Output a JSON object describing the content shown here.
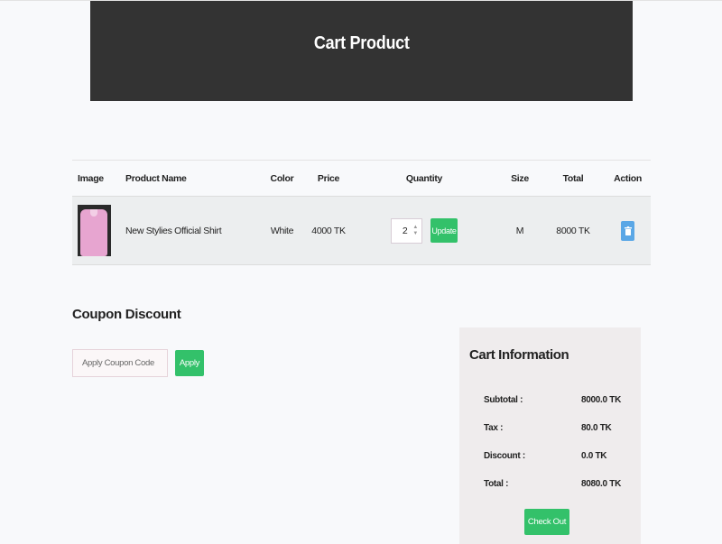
{
  "banner": {
    "title": "Cart Product"
  },
  "table": {
    "headers": {
      "image": "Image",
      "product_name": "Product Name",
      "color": "Color",
      "price": "Price",
      "quantity": "Quantity",
      "size": "Size",
      "total": "Total",
      "action": "Action"
    },
    "rows": [
      {
        "product_name": "New Stylies Official Shirt",
        "color": "White",
        "price": "4000 TK",
        "quantity": "2",
        "update_label": "Update",
        "size": "M",
        "total": "8000 TK",
        "delete_icon": "trash-icon"
      }
    ]
  },
  "coupon": {
    "title": "Coupon Discount",
    "placeholder": "Apply Coupon Code",
    "apply_label": "Apply"
  },
  "cart_info": {
    "title": "Cart Information",
    "rows": [
      {
        "label": "Subtotal :",
        "value": "8000.0 TK"
      },
      {
        "label": "Tax :",
        "value": "80.0 TK"
      },
      {
        "label": "Discount :",
        "value": "0.0 TK"
      },
      {
        "label": "Total :",
        "value": "8080.0 TK"
      }
    ],
    "checkout_label": "Check Out"
  },
  "colors": {
    "banner_bg": "#333333",
    "button_green": "#33c16a",
    "delete_blue": "#5aa7e6"
  }
}
